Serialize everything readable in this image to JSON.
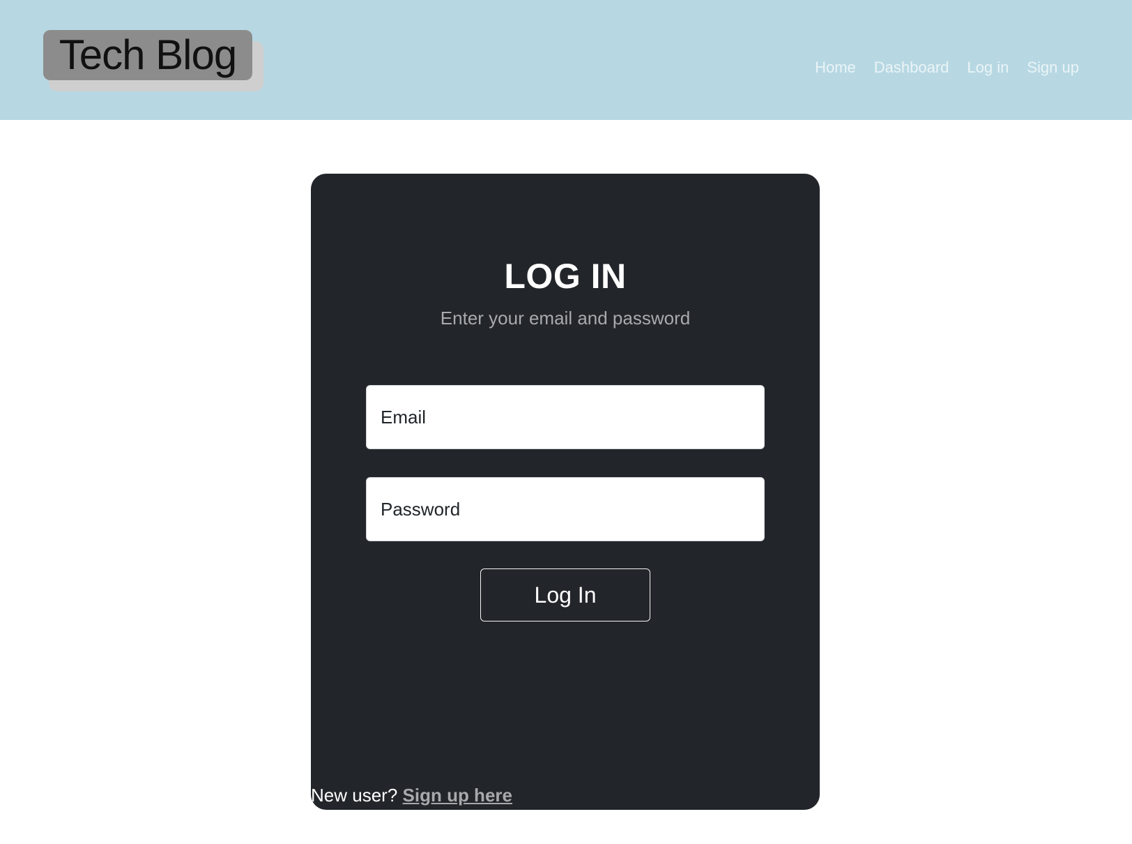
{
  "header": {
    "logo_text": "Tech Blog",
    "background_color": "#b7d8e3",
    "nav": [
      {
        "label": "Home"
      },
      {
        "label": "Dashboard"
      },
      {
        "label": "Log in"
      },
      {
        "label": "Sign up"
      }
    ]
  },
  "login_card": {
    "title": "LOG IN",
    "subtitle": "Enter your email and password",
    "email_placeholder": "Email",
    "email_value": "",
    "password_placeholder": "Password",
    "password_value": "",
    "submit_label": "Log In",
    "footer_prompt": "New user?",
    "signup_link": "Sign up here",
    "background_color": "#222529"
  }
}
